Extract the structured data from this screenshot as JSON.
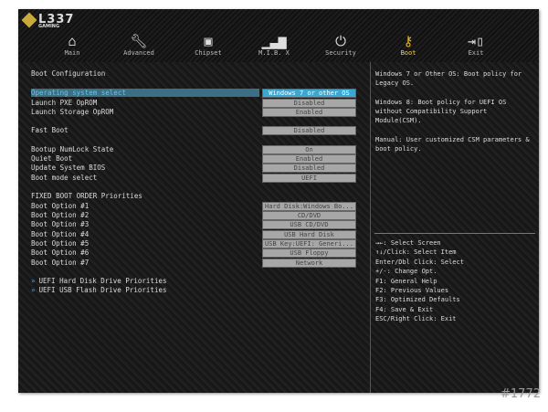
{
  "brand": {
    "name": "L337",
    "sub": "GAMING"
  },
  "tabs": [
    {
      "label": "Main",
      "icon": "home-icon"
    },
    {
      "label": "Advanced",
      "icon": "wrench-icon"
    },
    {
      "label": "Chipset",
      "icon": "chip-icon"
    },
    {
      "label": "M.I.B. X",
      "icon": "chart-icon"
    },
    {
      "label": "Security",
      "icon": "power-icon"
    },
    {
      "label": "Boot",
      "icon": "key-icon"
    },
    {
      "label": "Exit",
      "icon": "exit-icon"
    }
  ],
  "section_title": "Boot Configuration",
  "settings": [
    {
      "label": "Operating system select",
      "value": "Windows 7 or other OS"
    },
    {
      "label": "Launch PXE OpROM",
      "value": "Disabled"
    },
    {
      "label": "Launch Storage OpROM",
      "value": "Enabled"
    },
    {
      "label": "Fast Boot",
      "value": "Disabled"
    },
    {
      "label": "Bootup NumLock State",
      "value": "On"
    },
    {
      "label": "Quiet Boot",
      "value": "Enabled"
    },
    {
      "label": "Update System BIOS",
      "value": "Disabled"
    },
    {
      "label": "Boot mode select",
      "value": "UEFI"
    }
  ],
  "boot_order_title": "FIXED BOOT ORDER Priorities",
  "boot_options": [
    {
      "label": "Boot Option #1",
      "value": "Hard Disk:Windows Bo..."
    },
    {
      "label": "Boot Option #2",
      "value": "CD/DVD"
    },
    {
      "label": "Boot Option #3",
      "value": "USB CD/DVD"
    },
    {
      "label": "Boot Option #4",
      "value": "USB Hard Disk"
    },
    {
      "label": "Boot Option #5",
      "value": "USB Key:UEFI: Generi..."
    },
    {
      "label": "Boot Option #6",
      "value": "USB Floppy"
    },
    {
      "label": "Boot Option #7",
      "value": "Network"
    }
  ],
  "submenus": [
    "UEFI Hard Disk Drive Priorities",
    "UEFI USB Flash Drive Priorities"
  ],
  "help": "Windows 7 or Other OS: Boot policy for Legacy OS.\n\nWindows 8: Boot policy for UEFI OS without Compatibility Support Module(CSM).\n\nManual: User customized CSM parameters & boot policy.",
  "keys": [
    "→←: Select Screen",
    "↑↓/Click: Select Item",
    "Enter/Dbl Click: Select",
    "+/-: Change Opt.",
    "F1: General Help",
    "F2: Previous Values",
    "F3: Optimized Defaults",
    "F4: Save & Exit",
    "ESC/Right Click: Exit"
  ],
  "watermark": "#1772"
}
